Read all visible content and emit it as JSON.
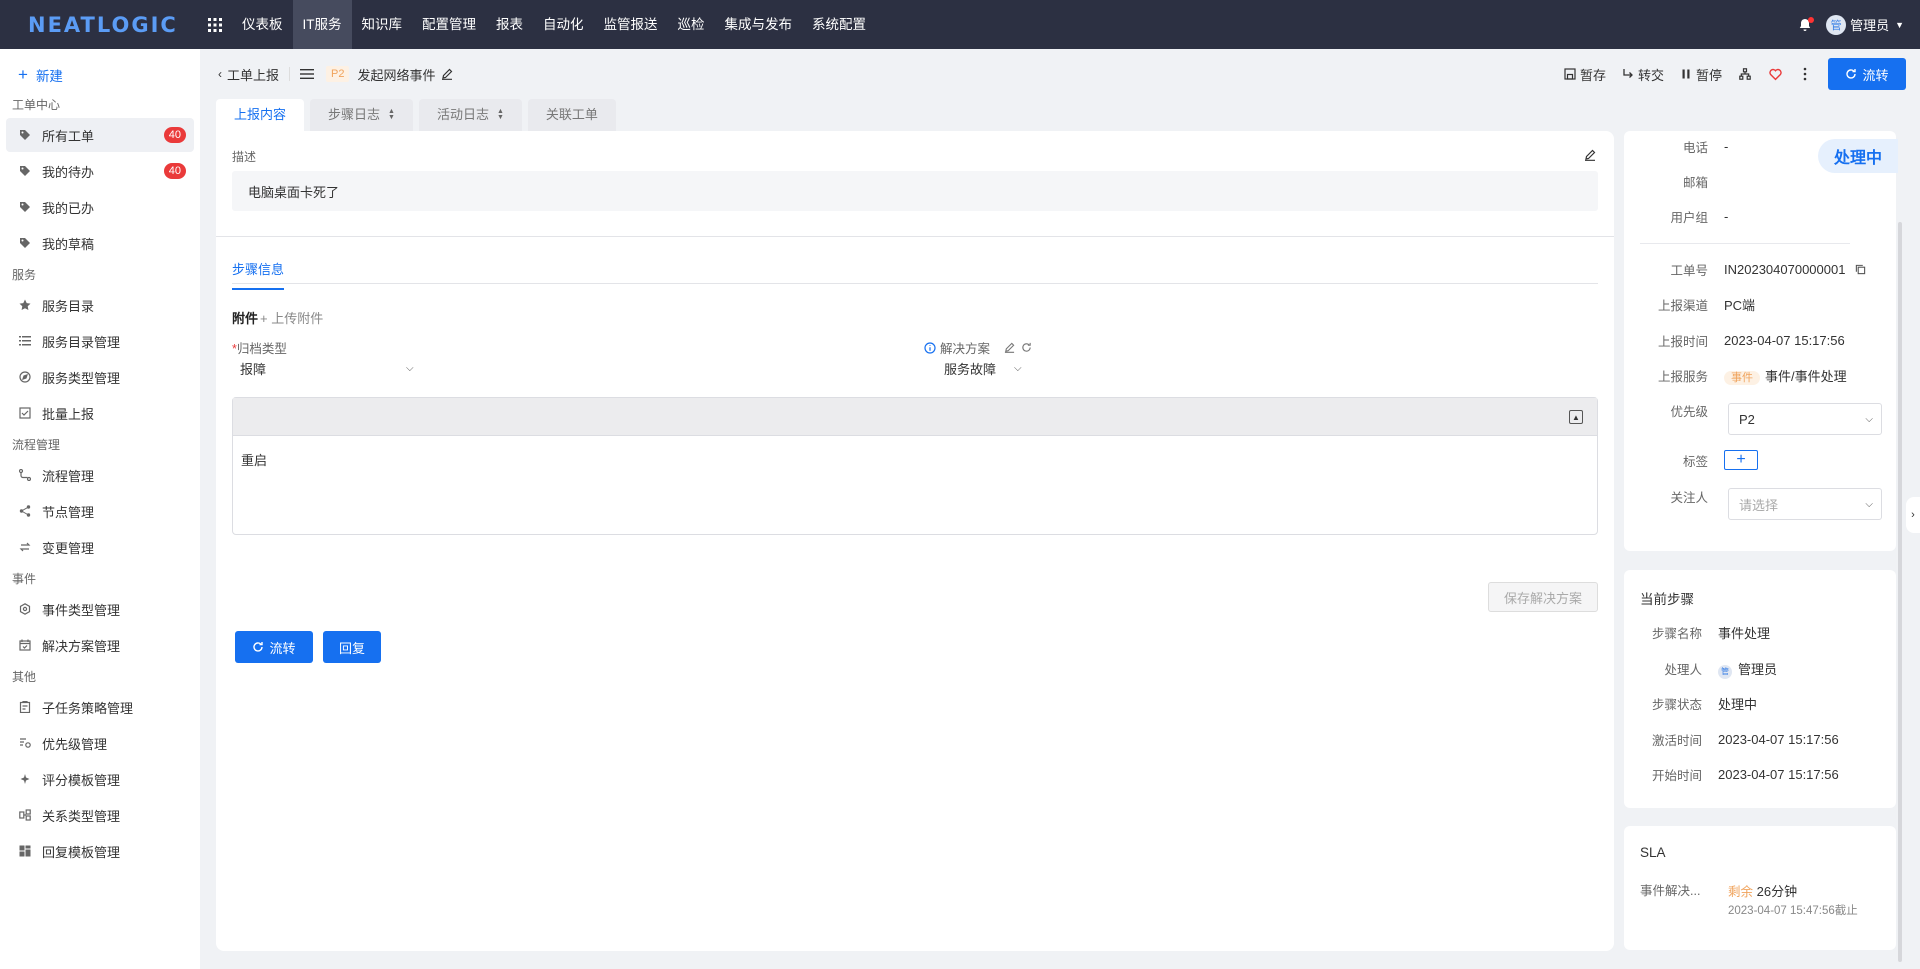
{
  "brand": "NEATLOGIC",
  "nav": [
    "仪表板",
    "IT服务",
    "知识库",
    "配置管理",
    "报表",
    "自动化",
    "监管报送",
    "巡检",
    "集成与发布",
    "系统配置"
  ],
  "nav_active": "IT服务",
  "user": {
    "avatar_text": "管",
    "name": "管理员"
  },
  "sidebar": {
    "new_label": "新建",
    "groups": [
      {
        "title": "工单中心",
        "items": [
          {
            "label": "所有工单",
            "icon": "tag-icon",
            "badge": "40",
            "active": true
          },
          {
            "label": "我的待办",
            "icon": "tag-icon",
            "badge": "40"
          },
          {
            "label": "我的已办",
            "icon": "tag-icon"
          },
          {
            "label": "我的草稿",
            "icon": "tag-icon"
          }
        ]
      },
      {
        "title": "服务",
        "items": [
          {
            "label": "服务目录",
            "icon": "star-icon"
          },
          {
            "label": "服务目录管理",
            "icon": "list-icon"
          },
          {
            "label": "服务类型管理",
            "icon": "compass-icon"
          },
          {
            "label": "批量上报",
            "icon": "checklist-icon"
          }
        ]
      },
      {
        "title": "流程管理",
        "items": [
          {
            "label": "流程管理",
            "icon": "flow-icon"
          },
          {
            "label": "节点管理",
            "icon": "share-icon"
          },
          {
            "label": "变更管理",
            "icon": "swap-icon"
          }
        ]
      },
      {
        "title": "事件",
        "items": [
          {
            "label": "事件类型管理",
            "icon": "hexagon-icon"
          },
          {
            "label": "解决方案管理",
            "icon": "calendar-check-icon"
          }
        ]
      },
      {
        "title": "其他",
        "items": [
          {
            "label": "子任务策略管理",
            "icon": "clipboard-icon"
          },
          {
            "label": "优先级管理",
            "icon": "priority-icon"
          },
          {
            "label": "评分模板管理",
            "icon": "sparkle-icon"
          },
          {
            "label": "关系类型管理",
            "icon": "relation-icon"
          },
          {
            "label": "回复模板管理",
            "icon": "grid-icon"
          }
        ]
      }
    ]
  },
  "header": {
    "back_label": "工单上报",
    "priority": "P2",
    "title": "发起网络事件",
    "actions": {
      "save": "暂存",
      "transfer": "转交",
      "pause": "暂停"
    },
    "flow_label": "流转"
  },
  "tabs": [
    "上报内容",
    "步骤日志",
    "活动日志",
    "关联工单"
  ],
  "content": {
    "desc_label": "描述",
    "desc_value": "电脑桌面卡死了",
    "step_tab": "步骤信息",
    "attach_label": "附件",
    "attach_upload": "上传附件",
    "archive_label": "归档类型",
    "archive_value": "报障",
    "solution_label": "解决方案",
    "solution_value": "服务故障",
    "editor_text": "重启",
    "save_solution": "保存解决方案",
    "btn_flow": "流转",
    "btn_reply": "回复"
  },
  "info": {
    "status": "处理中",
    "phone_label": "电话",
    "phone": "-",
    "email_label": "邮箱",
    "email": "",
    "group_label": "用户组",
    "group": "-",
    "ticket_label": "工单号",
    "ticket": "IN202304070000001",
    "channel_label": "上报渠道",
    "channel": "PC端",
    "time_label": "上报时间",
    "time": "2023-04-07 15:17:56",
    "service_label": "上报服务",
    "service_tag": "事件",
    "service": "事件/事件处理",
    "priority_label": "优先级",
    "priority": "P2",
    "tags_label": "标签",
    "watcher_label": "关注人",
    "watcher_placeholder": "请选择"
  },
  "current_step": {
    "title": "当前步骤",
    "name_label": "步骤名称",
    "name": "事件处理",
    "handler_label": "处理人",
    "handler_avatar": "管",
    "handler": "管理员",
    "status_label": "步骤状态",
    "status": "处理中",
    "activate_label": "激活时间",
    "activate": "2023-04-07 15:17:56",
    "start_label": "开始时间",
    "start": "2023-04-07 15:17:56"
  },
  "sla": {
    "title": "SLA",
    "item_label": "事件解决...",
    "remain_label": "剩余",
    "remain": "26分钟",
    "deadline": "2023-04-07 15:47:56截止"
  },
  "colors": {
    "primary": "#1670f0",
    "topbar": "#2c3042",
    "badge": "#ea3a3a",
    "tag_orange": "#f0a35c"
  }
}
